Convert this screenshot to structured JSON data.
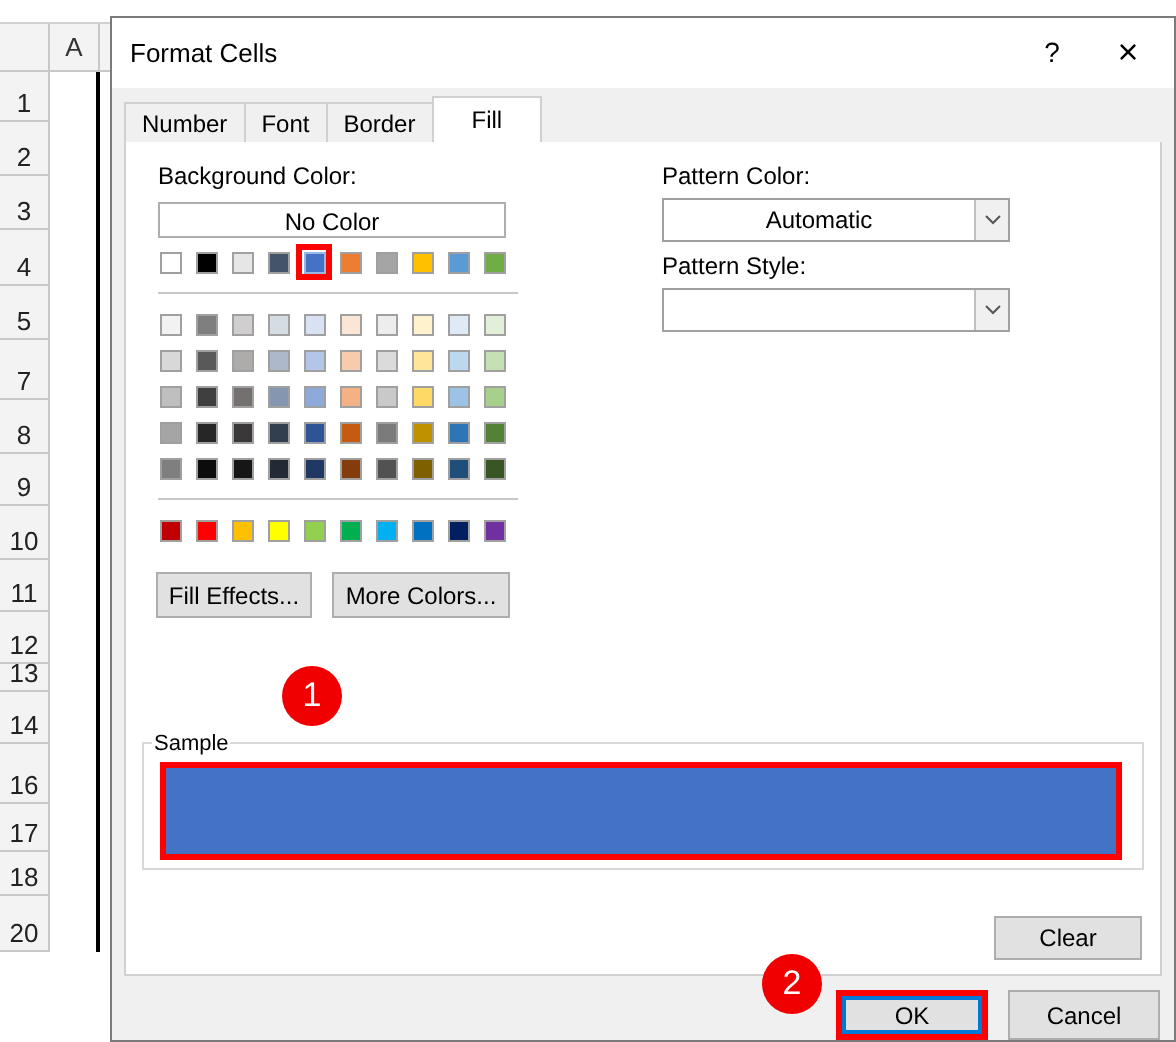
{
  "sheet": {
    "column_header": "A",
    "rows": [
      "1",
      "2",
      "3",
      "4",
      "5",
      "7",
      "8",
      "9",
      "10",
      "11",
      "12",
      "13",
      "14",
      "16",
      "17",
      "18",
      "20"
    ]
  },
  "dialog": {
    "title": "Format Cells",
    "help": "?",
    "close": "×",
    "tabs": [
      {
        "label": "Number",
        "selected": false
      },
      {
        "label": "Font",
        "selected": false
      },
      {
        "label": "Border",
        "selected": false
      },
      {
        "label": "Fill",
        "selected": true
      }
    ],
    "background_color": {
      "label": "Background Color:",
      "no_color": "No Color",
      "theme_colors": [
        [
          {
            "color": "#ffffff",
            "selected": false
          },
          {
            "color": "#000000",
            "selected": false
          },
          {
            "color": "#e7e6e6",
            "selected": false
          },
          {
            "color": "#44546a",
            "selected": false
          },
          {
            "color": "#4472c4",
            "selected": true
          },
          {
            "color": "#ed7d31",
            "selected": false
          },
          {
            "color": "#a5a5a5",
            "selected": false
          },
          {
            "color": "#ffc000",
            "selected": false
          },
          {
            "color": "#5b9bd5",
            "selected": false
          },
          {
            "color": "#70ad47",
            "selected": false
          }
        ]
      ],
      "shades": [
        [
          {
            "color": "#f2f2f2",
            "selected": false
          },
          {
            "color": "#7f7f7f",
            "selected": false
          },
          {
            "color": "#d0cece",
            "selected": false
          },
          {
            "color": "#d6dce4",
            "selected": false
          },
          {
            "color": "#d9e2f3",
            "selected": false
          },
          {
            "color": "#fbe5d5",
            "selected": false
          },
          {
            "color": "#ededed",
            "selected": false
          },
          {
            "color": "#fff2cc",
            "selected": false
          },
          {
            "color": "#deebf6",
            "selected": false
          },
          {
            "color": "#e2efd9",
            "selected": false
          }
        ],
        [
          {
            "color": "#d8d8d8",
            "selected": false
          },
          {
            "color": "#595959",
            "selected": false
          },
          {
            "color": "#aeabab",
            "selected": false
          },
          {
            "color": "#adb9ca",
            "selected": false
          },
          {
            "color": "#b4c6e7",
            "selected": false
          },
          {
            "color": "#f7cbac",
            "selected": false
          },
          {
            "color": "#dbdbdb",
            "selected": false
          },
          {
            "color": "#fee599",
            "selected": false
          },
          {
            "color": "#bdd7ee",
            "selected": false
          },
          {
            "color": "#c5e0b3",
            "selected": false
          }
        ],
        [
          {
            "color": "#bfbfbf",
            "selected": false
          },
          {
            "color": "#3f3f3f",
            "selected": false
          },
          {
            "color": "#757070",
            "selected": false
          },
          {
            "color": "#8496b0",
            "selected": false
          },
          {
            "color": "#8eaadb",
            "selected": false
          },
          {
            "color": "#f4b183",
            "selected": false
          },
          {
            "color": "#c9c9c9",
            "selected": false
          },
          {
            "color": "#ffd965",
            "selected": false
          },
          {
            "color": "#9cc3e5",
            "selected": false
          },
          {
            "color": "#a8d08d",
            "selected": false
          }
        ],
        [
          {
            "color": "#a5a5a5",
            "selected": false
          },
          {
            "color": "#262626",
            "selected": false
          },
          {
            "color": "#3a3838",
            "selected": false
          },
          {
            "color": "#323f4f",
            "selected": false
          },
          {
            "color": "#2f5496",
            "selected": false
          },
          {
            "color": "#c55a11",
            "selected": false
          },
          {
            "color": "#7b7b7b",
            "selected": false
          },
          {
            "color": "#bf9000",
            "selected": false
          },
          {
            "color": "#2e75b5",
            "selected": false
          },
          {
            "color": "#538135",
            "selected": false
          }
        ],
        [
          {
            "color": "#7f7f7f",
            "selected": false
          },
          {
            "color": "#0c0c0c",
            "selected": false
          },
          {
            "color": "#171616",
            "selected": false
          },
          {
            "color": "#222a35",
            "selected": false
          },
          {
            "color": "#1f3864",
            "selected": false
          },
          {
            "color": "#833c0b",
            "selected": false
          },
          {
            "color": "#525252",
            "selected": false
          },
          {
            "color": "#7f6000",
            "selected": false
          },
          {
            "color": "#1e4e79",
            "selected": false
          },
          {
            "color": "#375623",
            "selected": false
          }
        ]
      ],
      "standard_colors": [
        [
          {
            "color": "#c00000",
            "selected": false
          },
          {
            "color": "#ff0000",
            "selected": false
          },
          {
            "color": "#ffc000",
            "selected": false
          },
          {
            "color": "#ffff00",
            "selected": false
          },
          {
            "color": "#92d050",
            "selected": false
          },
          {
            "color": "#00b050",
            "selected": false
          },
          {
            "color": "#00b0f0",
            "selected": false
          },
          {
            "color": "#0070c0",
            "selected": false
          },
          {
            "color": "#002060",
            "selected": false
          },
          {
            "color": "#7030a0",
            "selected": false
          }
        ]
      ]
    },
    "fill_effects_button": "Fill Effects...",
    "more_colors_button": "More Colors...",
    "pattern_color": {
      "label": "Pattern Color:",
      "value": "Automatic"
    },
    "pattern_style": {
      "label": "Pattern Style:"
    },
    "step_markers": [
      "1",
      "2"
    ],
    "sample": {
      "label": "Sample",
      "highlighted": true
    },
    "clear_button": "Clear",
    "buttons": [
      {
        "label": "OK",
        "highlighted": true
      },
      {
        "label": "Cancel",
        "highlighted": false
      }
    ]
  }
}
